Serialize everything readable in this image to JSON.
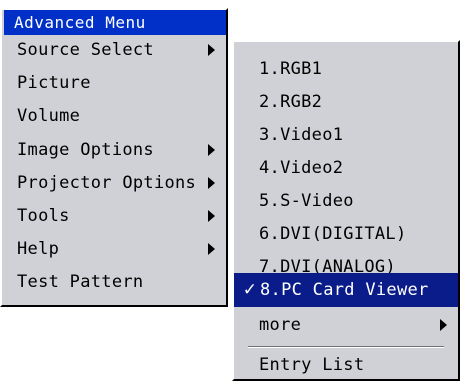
{
  "main_menu": {
    "title": "Advanced Menu",
    "items": [
      {
        "label": "Source Select",
        "submenu": true
      },
      {
        "label": "Picture",
        "submenu": false
      },
      {
        "label": "Volume",
        "submenu": false
      },
      {
        "label": "Image Options",
        "submenu": true
      },
      {
        "label": "Projector Options",
        "submenu": true
      },
      {
        "label": "Tools",
        "submenu": true
      },
      {
        "label": "Help",
        "submenu": true
      },
      {
        "label": "Test Pattern",
        "submenu": false
      }
    ]
  },
  "source_menu": {
    "items": [
      {
        "label": "1.RGB1"
      },
      {
        "label": "2.RGB2"
      },
      {
        "label": "3.Video1"
      },
      {
        "label": "4.Video2"
      },
      {
        "label": "5.S-Video"
      },
      {
        "label": "6.DVI(DIGITAL)"
      },
      {
        "label": "7.DVI(ANALOG)"
      },
      {
        "label": "8.PC Card Viewer",
        "selected": true,
        "check": "✓"
      },
      {
        "label": "more",
        "submenu": true
      },
      {
        "label": "Entry List"
      }
    ]
  },
  "colors": {
    "menu_bg": "#cfd1d6",
    "title_bg": "#0030c8",
    "selected_bg": "#0a1c8a",
    "text": "#000000",
    "selected_text": "#ffffff"
  }
}
